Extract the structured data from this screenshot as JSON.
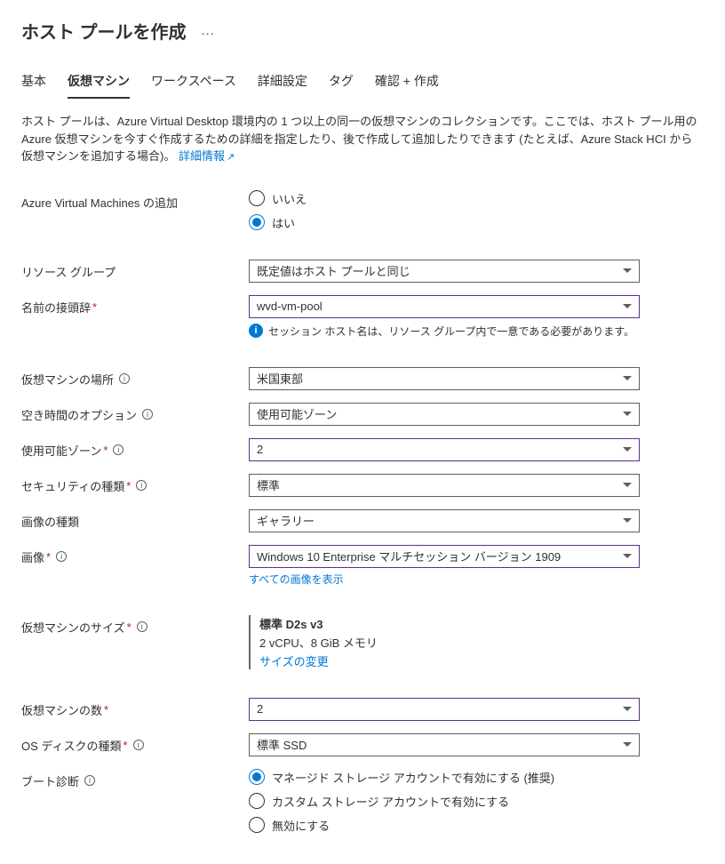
{
  "header": {
    "title": "ホスト プールを作成"
  },
  "tabs": {
    "basic": "基本",
    "vm": "仮想マシン",
    "workspace": "ワークスペース",
    "advanced": "詳細設定",
    "tags": "タグ",
    "review": "確認 + 作成"
  },
  "description": {
    "text": "ホスト プールは、Azure Virtual Desktop 環境内の 1 つ以上の同一の仮想マシンのコレクションです。ここでは、ホスト プール用のAzure 仮想マシンを今すぐ作成するための詳細を指定したり、後で作成して追加したりできます (たとえば、Azure Stack HCI から仮想マシンを追加する場合)。",
    "link": "詳細情報"
  },
  "labels": {
    "addVm": "Azure Virtual Machines の追加",
    "resourceGroup": "リソース グループ",
    "namePrefix": "名前の接頭辞",
    "vmLocation": "仮想マシンの場所",
    "availOption": "空き時間のオプション",
    "availZone": "使用可能ゾーン",
    "securityType": "セキュリティの種類",
    "imageType": "画像の種類",
    "image": "画像",
    "vmSize": "仮想マシンのサイズ",
    "vmCount": "仮想マシンの数",
    "osDisk": "OS ディスクの種類",
    "bootDiag": "ブート診断"
  },
  "values": {
    "radioNo": "いいえ",
    "radioYes": "はい",
    "resourceGroup": "既定値はホスト プールと同じ",
    "namePrefix": "wvd-vm-pool",
    "namePrefixInfo": "セッション ホスト名は、リソース グループ内で一意である必要があります。",
    "vmLocation": "米国東部",
    "availOption": "使用可能ゾーン",
    "availZone": "2",
    "securityType": "標準",
    "imageType": "ギャラリー",
    "image": "Windows 10 Enterprise マルチセッション バージョン 1909",
    "imageLink": "すべての画像を表示",
    "sizeTitle": "標準 D2s v3",
    "sizeSub": "2 vCPU、8 GiB メモリ",
    "sizeLink": "サイズの変更",
    "vmCount": "2",
    "osDisk": "標準 SSD",
    "bootDiag1": "マネージド ストレージ アカウントで有効にする (推奨)",
    "bootDiag2": "カスタム ストレージ アカウントで有効にする",
    "bootDiag3": "無効にする"
  }
}
